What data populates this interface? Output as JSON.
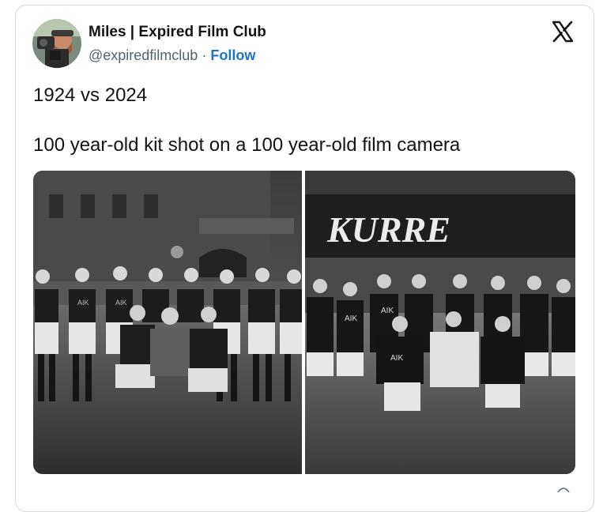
{
  "tweet": {
    "display_name": "Miles | Expired Film Club",
    "handle": "@expiredfilmclub",
    "separator": "·",
    "follow_label": "Follow",
    "text_line_1": "1924 vs 2024",
    "text_line_2": "100 year-old kit shot on a 100 year-old film camera"
  },
  "media": {
    "left_photo": {
      "shirt_text": "AIK"
    },
    "right_photo": {
      "banner_text": "KURRE",
      "shirt_text": "AIK"
    }
  },
  "icons": {
    "brand": "x-logo-icon"
  },
  "colors": {
    "follow": "#1d74c4",
    "text": "#0f1419",
    "secondary": "#536471",
    "border": "#cfd9de"
  }
}
